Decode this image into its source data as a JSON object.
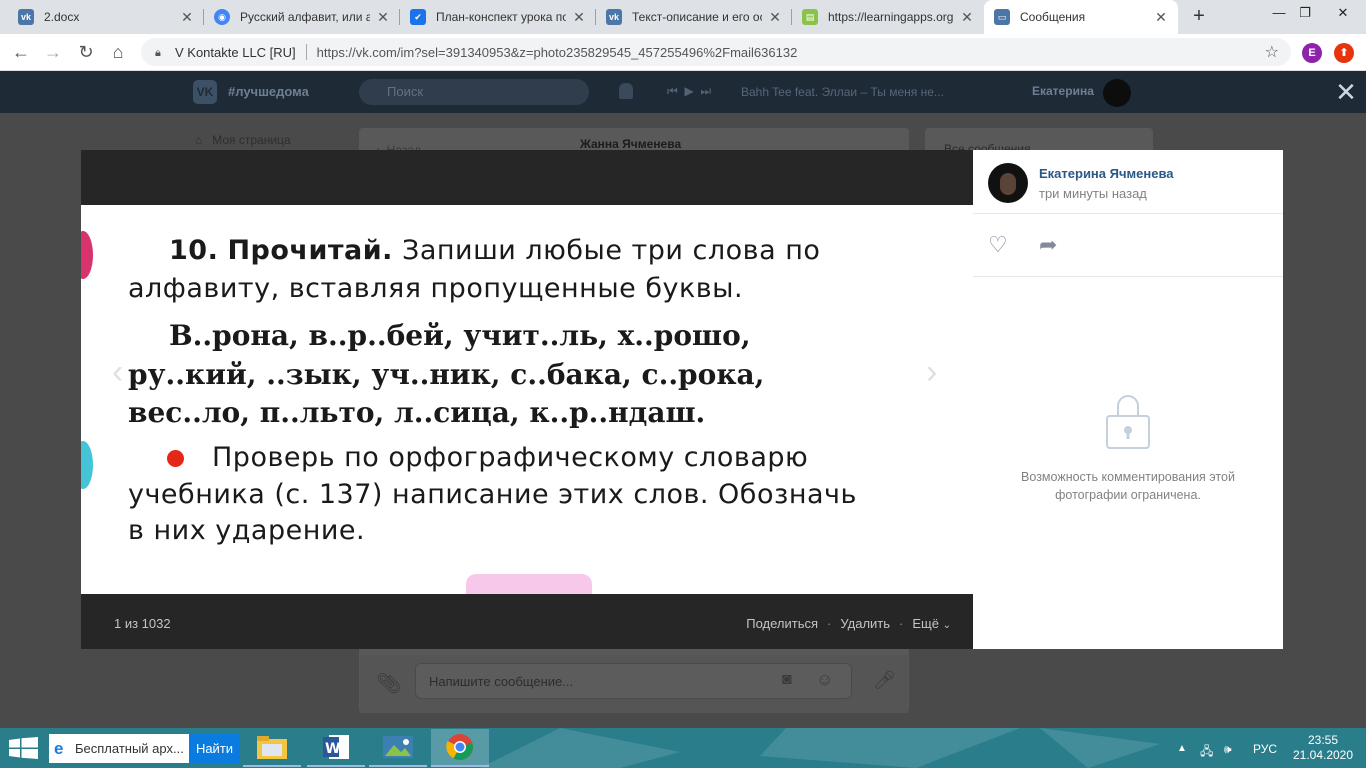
{
  "browser": {
    "tabs": [
      {
        "title": "2.docx",
        "favicon": "vk-icon",
        "color": "#4a76a8"
      },
      {
        "title": "Русский алфавит, или алфавит",
        "favicon": "google-assistant-icon",
        "color": "#4285f4"
      },
      {
        "title": "План-конспект урока по русскому",
        "favicon": "checkmark-icon",
        "color": "#1a73e8"
      },
      {
        "title": "Текст-описание и его особенности",
        "favicon": "vk-icon",
        "color": "#4a76a8"
      },
      {
        "title": "https://learningapps.org",
        "favicon": "learningapps-icon",
        "color": "#8bc34a"
      },
      {
        "title": "Сообщения",
        "favicon": "vk-messages-icon",
        "color": "#4a76a8"
      }
    ],
    "cert_label": "V Kontakte LLC [RU]",
    "url": "https://vk.com/im?sel=391340953&z=photo235829545_457255496%2Fmail636132",
    "profile_initial": "E",
    "profile_color": "#8e24aa",
    "ext_color": "#e8330f"
  },
  "vk": {
    "logo": "VK",
    "slogan": "#лучшедома",
    "search_placeholder": "Поиск",
    "track": "Bahh Tee feat. Эллаи – Ты меня не...",
    "user_name": "Екатерина",
    "left_menu_first": "Моя страница",
    "chat_name": "Жанна Ячменева",
    "chat_back": "Назад",
    "right_panel_label": "Все сообщения",
    "composer_placeholder": "Напишите сообщение..."
  },
  "photo": {
    "line1_num": "10.",
    "line1_bold": "Прочитай.",
    "line1_rest": "Запиши любые три слова по",
    "line2": "алфавиту, вставляя пропущенные буквы.",
    "line3": "В..рона,   в..р..бей,   учит..ль,   х..рошо,",
    "line4": "ру..кий,  ..зык,  уч..ник,  с..бака,  с..рока,",
    "line5": "вес..ло,  п..льто,  л..сица,  к..р..ндаш.",
    "line6": "Проверь по орфографическому словарю",
    "line7": "учебника (с. 137) написание этих слов. Обозначь",
    "line8": "в них ударение."
  },
  "viewer": {
    "counter": "1 из 1032",
    "share": "Поделиться",
    "delete": "Удалить",
    "more": "Ещё",
    "author": "Екатерина Ячменева",
    "time": "три минуты назад",
    "restricted_text": "Возможность комментирования этой фотографии ограничена."
  },
  "taskbar": {
    "search_text": "Бесплатный арх...",
    "find_button": "Найти",
    "language": "РУС",
    "time": "23:55",
    "date": "21.04.2020"
  }
}
